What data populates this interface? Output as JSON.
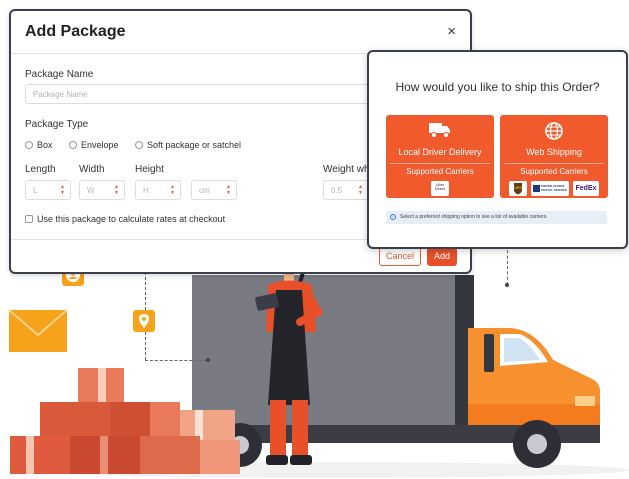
{
  "package_dialog": {
    "title": "Add Package",
    "close_glyph": "×",
    "name_label": "Package Name",
    "name_placeholder": "Package Name",
    "type_label": "Package Type",
    "type_options": [
      "Box",
      "Envelope",
      "Soft package or satchel"
    ],
    "length_label": "Length",
    "width_label": "Width",
    "height_label": "Height",
    "weight_label": "Weight wh",
    "length_placeholder": "L",
    "width_placeholder": "W",
    "height_placeholder": "H",
    "unit_placeholder": "cm",
    "weight_placeholder": "0.5",
    "checkbox_label": "Use this package to calculate rates at checkout",
    "cancel_label": "Cancel",
    "add_label": "Add"
  },
  "shipping_modal": {
    "question": "How would you like to ship this Order?",
    "options": [
      {
        "title": "Local Driver Delivery",
        "subtitle": "Supported Carriers",
        "icon": "truck-icon",
        "carriers": [
          "Uber Direct"
        ]
      },
      {
        "title": "Web Shipping",
        "subtitle": "Supported Carriers",
        "icon": "globe-icon",
        "carriers": [
          "UPS",
          "UNITED STATES POSTAL SERVICE",
          "FedEx"
        ]
      }
    ],
    "info_text": "Select a preferred shipping option to see a list of available carriers."
  },
  "colors": {
    "accent": "#f05a2c",
    "dialog_border": "#3a3f4c",
    "truck_body": "#7a7a80",
    "truck_cab": "#f57b1f",
    "badge": "#f7a21b"
  }
}
